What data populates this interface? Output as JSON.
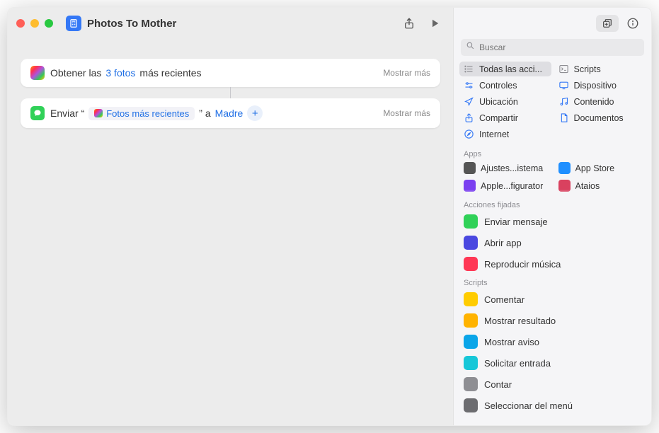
{
  "window": {
    "title": "Photos To Mother"
  },
  "toolbar": {
    "share": "share",
    "run": "run"
  },
  "actions": {
    "more_label": "Mostrar más",
    "get_photos": {
      "prefix": "Obtener las",
      "count_text": "3 fotos",
      "suffix": "más recientes"
    },
    "send_message": {
      "prefix": "Enviar “",
      "variable": "Fotos más recientes",
      "mid": "” a",
      "recipient": "Madre"
    }
  },
  "sidebar": {
    "search_placeholder": "Buscar",
    "categories": [
      {
        "label": "Todas las acci...",
        "icon": "list",
        "color": "#8e8e93",
        "selected": true
      },
      {
        "label": "Scripts",
        "icon": "terminal",
        "color": "#8e8e93"
      },
      {
        "label": "Controles",
        "icon": "sliders",
        "color": "#3478f6"
      },
      {
        "label": "Dispositivo",
        "icon": "display",
        "color": "#3478f6"
      },
      {
        "label": "Ubicación",
        "icon": "location",
        "color": "#3478f6"
      },
      {
        "label": "Contenido",
        "icon": "music",
        "color": "#3478f6"
      },
      {
        "label": "Compartir",
        "icon": "share",
        "color": "#3478f6"
      },
      {
        "label": "Documentos",
        "icon": "doc",
        "color": "#3478f6"
      },
      {
        "label": "Internet",
        "icon": "safari",
        "color": "#3478f6"
      }
    ],
    "apps_label": "Apps",
    "apps": [
      {
        "label": "Ajustes...istema",
        "color": "#555"
      },
      {
        "label": "App Store",
        "color": "#1f8fff"
      },
      {
        "label": "Apple...figurator",
        "color": "#7a3ff0"
      },
      {
        "label": "Ataios",
        "color": "#d9415f"
      }
    ],
    "pinned_label": "Acciones fijadas",
    "pinned": [
      {
        "label": "Enviar mensaje",
        "color": "#30d158"
      },
      {
        "label": "Abrir app",
        "color": "#4a48e0"
      },
      {
        "label": "Reproducir música",
        "color": "#ff3755"
      }
    ],
    "scripts_label": "Scripts",
    "scripts": [
      {
        "label": "Comentar",
        "color": "#ffcc00"
      },
      {
        "label": "Mostrar resultado",
        "color": "#ffb300"
      },
      {
        "label": "Mostrar aviso",
        "color": "#0aa5e8"
      },
      {
        "label": "Solicitar entrada",
        "color": "#17c7d8"
      },
      {
        "label": "Contar",
        "color": "#8e8e93"
      },
      {
        "label": "Seleccionar del menú",
        "color": "#6c6c70"
      }
    ]
  }
}
